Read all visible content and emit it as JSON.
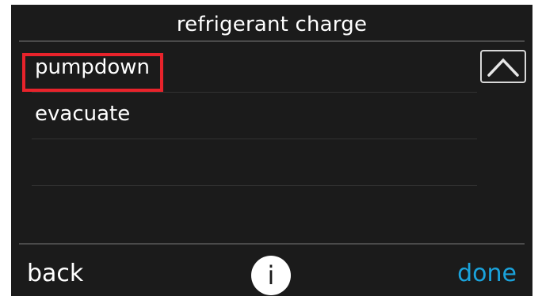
{
  "header": {
    "title": "refrigerant charge"
  },
  "list": {
    "items": [
      {
        "label": "pumpdown",
        "selected": true
      },
      {
        "label": "evacuate",
        "selected": false
      }
    ]
  },
  "footer": {
    "back_label": "back",
    "info_label": "i",
    "done_label": "done"
  },
  "icons": {
    "scroll_up": "chevron-up-icon",
    "info": "info-icon"
  },
  "colors": {
    "background": "#1b1b1b",
    "text": "#ffffff",
    "highlight": "#e8232b",
    "done": "#1aa3dc"
  }
}
